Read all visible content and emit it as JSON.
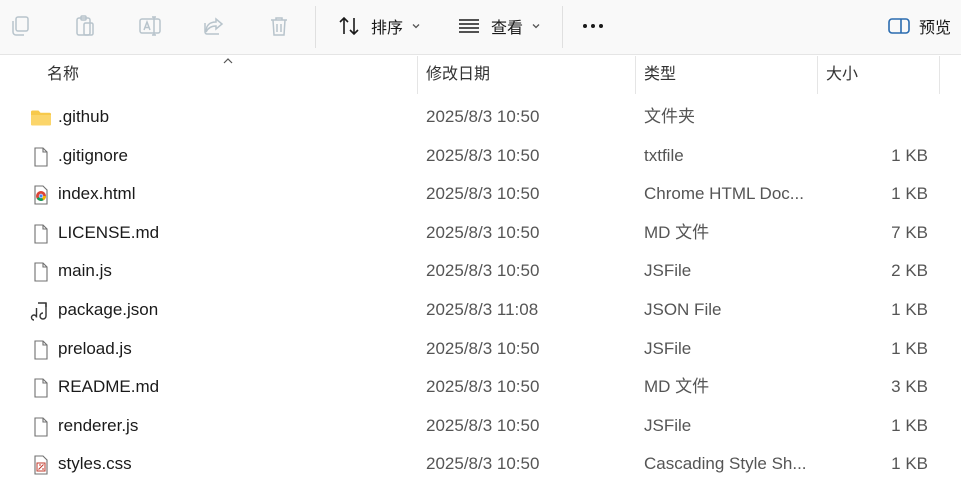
{
  "toolbar": {
    "sort_label": "排序",
    "view_label": "查看",
    "preview_label": "预览",
    "icons": [
      "copy-icon",
      "paste-icon",
      "rename-icon",
      "share-icon",
      "delete-icon",
      "sort-icon",
      "view-icon",
      "more-icon",
      "preview-pane-icon"
    ]
  },
  "columns": {
    "name": "名称",
    "modified": "修改日期",
    "type": "类型",
    "size": "大小"
  },
  "files": [
    {
      "name": ".github",
      "modified": "2025/8/3 10:50",
      "type": "文件夹",
      "size": "",
      "icon": "folder-icon"
    },
    {
      "name": ".gitignore",
      "modified": "2025/8/3 10:50",
      "type": "txtfile",
      "size": "1 KB",
      "icon": "file-icon"
    },
    {
      "name": "index.html",
      "modified": "2025/8/3 10:50",
      "type": "Chrome HTML Doc...",
      "size": "1 KB",
      "icon": "chrome-html-icon"
    },
    {
      "name": "LICENSE.md",
      "modified": "2025/8/3 10:50",
      "type": "MD 文件",
      "size": "7 KB",
      "icon": "file-icon"
    },
    {
      "name": "main.js",
      "modified": "2025/8/3 10:50",
      "type": "JSFile",
      "size": "2 KB",
      "icon": "file-icon"
    },
    {
      "name": "package.json",
      "modified": "2025/8/3 11:08",
      "type": "JSON File",
      "size": "1 KB",
      "icon": "json-file-icon"
    },
    {
      "name": "preload.js",
      "modified": "2025/8/3 10:50",
      "type": "JSFile",
      "size": "1 KB",
      "icon": "file-icon"
    },
    {
      "name": "README.md",
      "modified": "2025/8/3 10:50",
      "type": "MD 文件",
      "size": "3 KB",
      "icon": "file-icon"
    },
    {
      "name": "renderer.js",
      "modified": "2025/8/3 10:50",
      "type": "JSFile",
      "size": "1 KB",
      "icon": "file-icon"
    },
    {
      "name": "styles.css",
      "modified": "2025/8/3 10:50",
      "type": "Cascading Style Sh...",
      "size": "1 KB",
      "icon": "css-file-icon"
    }
  ],
  "colors": {
    "toolbar_bg": "#f9f9f9",
    "disabled_icon": "#b8c4cc",
    "folder": "#f7c94b",
    "accent": "#2b6cb0"
  }
}
